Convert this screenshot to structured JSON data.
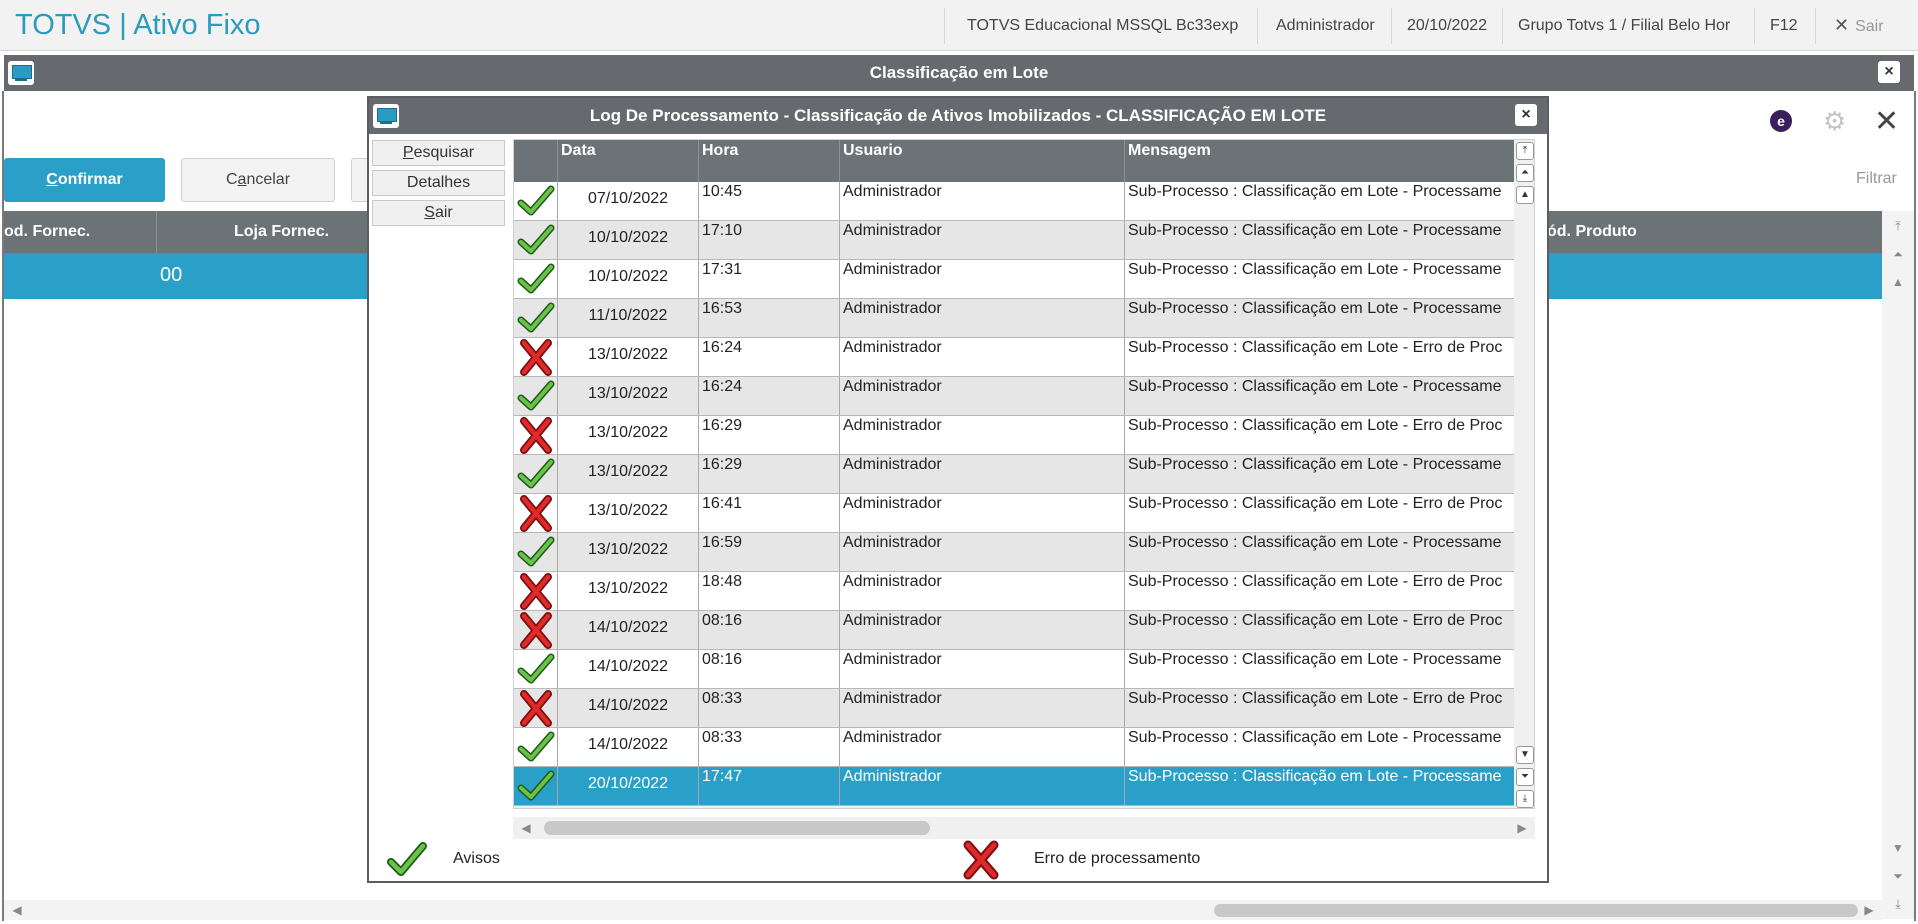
{
  "app": {
    "title": "TOTVS | Ativo Fixo",
    "environment": "TOTVS Educacional MSSQL Bc33exp",
    "user": "Administrador",
    "date": "20/10/2022",
    "branch": "Grupo Totvs 1 / Filial Belo Hor",
    "shortcut": "F12",
    "exit_label": "Sair"
  },
  "main_window": {
    "title": "Classificação em Lote",
    "confirm_label": "onfirmar",
    "confirm_accel": "C",
    "cancel_pre": "C",
    "cancel_accel": "a",
    "cancel_post": "ncelar",
    "filter_label": "Filtrar",
    "profile_letter": "e",
    "columns": [
      "od. Fornec.",
      "Loja Fornec.",
      "ód. Produto"
    ],
    "row_value": "00"
  },
  "dialog": {
    "title": "Log De Processamento - Classificação de Ativos Imobilizados - CLASSIFICAÇÃO EM LOTE",
    "buttons": {
      "search_accel": "P",
      "search_rest": "esquisar",
      "details": "Detalhes",
      "exit_accel": "S",
      "exit_rest": "air"
    },
    "columns": {
      "date": "Data",
      "time": "Hora",
      "user": "Usuario",
      "message": "Mensagem"
    },
    "rows": [
      {
        "status": "ok",
        "date": "07/10/2022",
        "time": "10:45",
        "user": "Administrador",
        "message": "Sub-Processo : Classificação em Lote - Processame"
      },
      {
        "status": "ok",
        "date": "10/10/2022",
        "time": "17:10",
        "user": "Administrador",
        "message": "Sub-Processo : Classificação em Lote - Processame"
      },
      {
        "status": "ok",
        "date": "10/10/2022",
        "time": "17:31",
        "user": "Administrador",
        "message": "Sub-Processo : Classificação em Lote - Processame"
      },
      {
        "status": "ok",
        "date": "11/10/2022",
        "time": "16:53",
        "user": "Administrador",
        "message": "Sub-Processo : Classificação em Lote - Processame"
      },
      {
        "status": "error",
        "date": "13/10/2022",
        "time": "16:24",
        "user": "Administrador",
        "message": "Sub-Processo : Classificação em Lote - Erro de Proc"
      },
      {
        "status": "ok",
        "date": "13/10/2022",
        "time": "16:24",
        "user": "Administrador",
        "message": "Sub-Processo : Classificação em Lote - Processame"
      },
      {
        "status": "error",
        "date": "13/10/2022",
        "time": "16:29",
        "user": "Administrador",
        "message": "Sub-Processo : Classificação em Lote - Erro de Proc"
      },
      {
        "status": "ok",
        "date": "13/10/2022",
        "time": "16:29",
        "user": "Administrador",
        "message": "Sub-Processo : Classificação em Lote - Processame"
      },
      {
        "status": "error",
        "date": "13/10/2022",
        "time": "16:41",
        "user": "Administrador",
        "message": "Sub-Processo : Classificação em Lote - Erro de Proc"
      },
      {
        "status": "ok",
        "date": "13/10/2022",
        "time": "16:59",
        "user": "Administrador",
        "message": "Sub-Processo : Classificação em Lote - Processame"
      },
      {
        "status": "error",
        "date": "13/10/2022",
        "time": "18:48",
        "user": "Administrador",
        "message": "Sub-Processo : Classificação em Lote - Erro de Proc"
      },
      {
        "status": "error",
        "date": "14/10/2022",
        "time": "08:16",
        "user": "Administrador",
        "message": "Sub-Processo : Classificação em Lote - Erro de Proc"
      },
      {
        "status": "ok",
        "date": "14/10/2022",
        "time": "08:16",
        "user": "Administrador",
        "message": "Sub-Processo : Classificação em Lote - Processame"
      },
      {
        "status": "error",
        "date": "14/10/2022",
        "time": "08:33",
        "user": "Administrador",
        "message": "Sub-Processo : Classificação em Lote - Erro de Proc"
      },
      {
        "status": "ok",
        "date": "14/10/2022",
        "time": "08:33",
        "user": "Administrador",
        "message": "Sub-Processo : Classificação em Lote - Processame"
      },
      {
        "status": "ok",
        "date": "20/10/2022",
        "time": "17:47",
        "user": "Administrador",
        "message": "Sub-Processo : Classificação em Lote - Processame",
        "selected": true
      }
    ],
    "legend": {
      "ok_label": "Avisos",
      "error_label": "Erro de processamento"
    }
  },
  "icons": {
    "ok": "check-icon",
    "error": "x-icon"
  },
  "colors": {
    "accent": "#2aa0c8",
    "title_bar": "#666a6e",
    "check_green": "#3a9a2a",
    "x_red": "#d42020"
  }
}
